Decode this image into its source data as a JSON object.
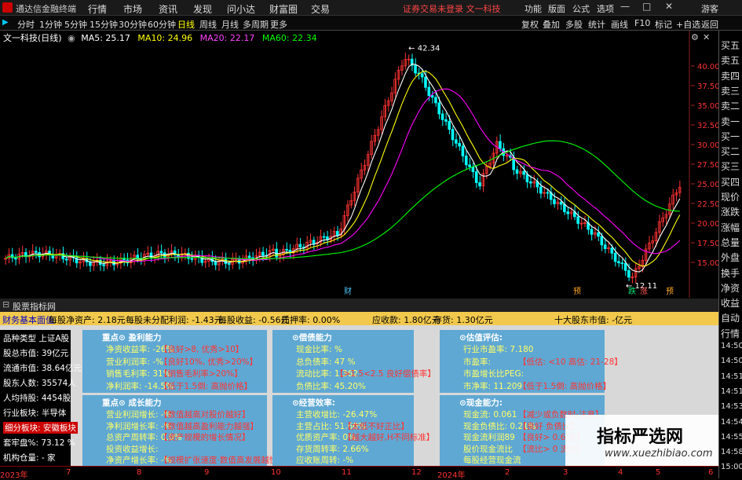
{
  "titlebar": {
    "app_title": "通达信金融终端",
    "menus": [
      "行情",
      "市场",
      "资讯",
      "发现",
      "问小达",
      "财富圈",
      "交易"
    ],
    "notice": "证券交易未登录  文一科技",
    "right_menus": [
      "功能",
      "版面",
      "公式",
      "选项"
    ],
    "guest": "游客"
  },
  "toolbar": {
    "periods": [
      "分时",
      "1分钟",
      "5分钟",
      "15分钟",
      "30分钟",
      "60分钟",
      "日线",
      "周线",
      "月线",
      "多周期",
      "更多"
    ],
    "right_items": [
      "复权",
      "叠加",
      "多股",
      "统计",
      "画线",
      "F10",
      "标记",
      "+自选",
      "返回"
    ]
  },
  "chart": {
    "stock_name": "文一科技(日线)",
    "ma5": "MA5: 25.17",
    "ma10": "MA10: 24.96",
    "ma20": "MA20: 22.17",
    "ma60": "MA60: 22.34",
    "high_label": "42.34",
    "low_label": "12.11",
    "price_ticks": [
      "40.00",
      "37.50",
      "35.00",
      "32.50",
      "30.00",
      "27.50",
      "25.00",
      "22.50",
      "20.00",
      "17.50",
      "15.00"
    ],
    "markers": [
      "财",
      "预",
      "跌",
      "涨",
      "预"
    ],
    "x_ticks": [
      "2023年",
      "7",
      "8",
      "9",
      "10",
      "11",
      "12",
      "2024年",
      "2",
      "3",
      "4",
      "5",
      "6"
    ],
    "colors": {
      "ma5": "#ffffff",
      "ma10": "#ffff00",
      "ma20": "#ff00ff",
      "ma60": "#00ff00",
      "up": "#ff3333",
      "down": "#00ffff"
    }
  },
  "sidebar": {
    "items": [
      "买五",
      "卖五",
      "卖四",
      "卖三",
      "卖二",
      "卖一",
      "买一",
      "买二",
      "买三",
      "买四",
      "现价",
      "涨跌",
      "涨幅",
      "总量",
      "外盘",
      "换手",
      "净资",
      "收益",
      "自动",
      "行情",
      "14:50",
      "14:50",
      "14:51",
      "14:51",
      "14:53",
      "14:54",
      "14:55",
      "14:58",
      "15:00"
    ]
  },
  "panel": {
    "title": "股票指标网",
    "summary": {
      "label": "财务基本面值",
      "nav": "每股净资产: 2.18元",
      "undist": "每股未分配利润: -1.43元",
      "eps": "每股收益: -0.56元",
      "pledge": "质押率: 0.00%",
      "receivable": "应收款: 1.80亿元",
      "inventory": "存货: 1.30亿元",
      "top10": "十大股东市值: -亿元"
    },
    "left_rows": [
      "品种类型  上证A股",
      "股总市值: 39亿元",
      "流通市值: 38.64亿元",
      "股东人数: 35574人",
      "人均持股: 4454股",
      "行业板块: 半导体",
      "细分板块: 安徽板块",
      "套牢盘%: 73.12 %",
      "机构仓量: - 家"
    ],
    "blocks": {
      "profit": {
        "title": "重点⊙ 盈利能力",
        "rows": [
          {
            "l": "净资收益率: -26%",
            "c": "【良好>8, 优秀>10】"
          },
          {
            "l": "营业利润率: -%",
            "c": "【良好10%, 优秀>20%】"
          },
          {
            "l": "销售毛利率: 31%",
            "c": "【销售毛利率>20%】"
          },
          {
            "l": "净利润率: -14.5%",
            "c": "【低于1.5倒: 高抛价格】"
          }
        ]
      },
      "debt": {
        "title": "⊙偿债能力",
        "rows": [
          {
            "l": "现金比率: %",
            "c": ""
          },
          {
            "l": "总负债率: 47 %",
            "c": ""
          },
          {
            "l": "流动比率: 1.362",
            "c": "【>1.5<2.5 良好偿债率】"
          },
          {
            "l": "负债比率: 45.20%",
            "c": ""
          }
        ]
      },
      "value": {
        "title": "⊙估值评估:",
        "rows": [
          {
            "l": "行业市盈率: 7.180",
            "c": ""
          },
          {
            "l": "市盈率:",
            "c": "【低估: <10 高估: 21-28】"
          },
          {
            "l": "市盈增长比PEG:",
            "c": ""
          },
          {
            "l": "市净率: 11.209",
            "c": "【低于1.5倒: 高抛价格】"
          }
        ]
      },
      "growth": {
        "title": "重点⊙ 成长能力",
        "rows": [
          {
            "l": "营业利润增长: -%",
            "c": "【数值越高对股价越好】"
          },
          {
            "l": "净利润增长率: -%",
            "c": "【数值越高盈利能力越强】"
          },
          {
            "l": "总资产周转率: 0.0%",
            "c": "【资产规模的增长情况】"
          },
          {
            "l": "投资收益增长: ",
            "c": ""
          },
          {
            "l": "净资产增长率: -%",
            "c": "【规模扩张速度·数值高发展越快】"
          }
        ]
      },
      "operate": {
        "title": "⊙经营效率:",
        "rows": [
          {
            "l": "主营收增比: -26.47%",
            "c": ""
          },
          {
            "l": "主营占比: 51.60%",
            "c": "【太低不好正比】"
          },
          {
            "l": "优质资产率: 0%",
            "c": "【越大越好,H不同标准】"
          },
          {
            "l": "存货周转率: 2.66%",
            "c": ""
          },
          {
            "l": "应收账周转: -%",
            "c": ""
          }
        ]
      },
      "cash": {
        "title": "⊙现金能力:",
        "rows": [
          {
            "l": "现金流: 0.061",
            "c": "【减少或负数时·注意】"
          },
          {
            "l": "现金负债比: 0.21%",
            "c": "【良好 负债比】"
          },
          {
            "l": "现金流利润89",
            "c": "【良好> 0.6 优】"
          },
          {
            "l": "股价现金流比",
            "c": "【流比> 0 流比】"
          },
          {
            "l": "每股经营现金流",
            "c": ""
          }
        ]
      }
    }
  },
  "watermark": {
    "line1": "指标严选网",
    "line2": "www.xuezhibiao.com"
  }
}
